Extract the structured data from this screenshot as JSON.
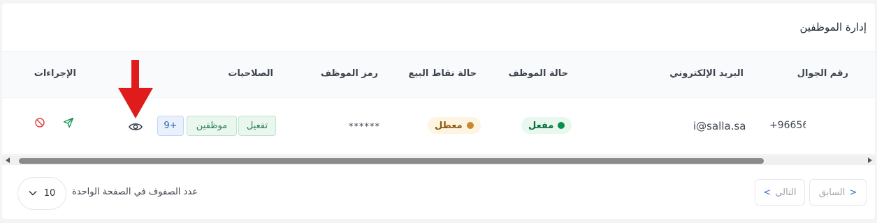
{
  "title": "إدارة الموظفين",
  "columns": {
    "mobile": "رقم الجوال",
    "email": "البريد الإلكتروني",
    "employee_status": "حالة الموظف",
    "pos_status": "حالة نقاط البيع",
    "employee_code": "رمز الموظف",
    "permissions": "الصلاحيات",
    "actions": "الإجراءات"
  },
  "row": {
    "mobile": "+96656",
    "email": "i@salla.sa",
    "employee_status": "مفعل",
    "pos_status": "معطل",
    "employee_code": "******",
    "permissions": [
      "تفعيل",
      "موظفين"
    ],
    "permissions_more": "9+"
  },
  "pagination": {
    "previous": "السابق",
    "next": "التالي",
    "rows_per_page_label": "عدد الصفوف في الصفحة الواحدة",
    "rows_per_page_value": "10"
  },
  "colors": {
    "active_green": "#0a8f4a",
    "disabled_orange": "#c98a2b",
    "permission_green": "#2e7d4f",
    "more_blue": "#2c5fb3",
    "red_arrow": "#e01b1b"
  },
  "icons": {
    "view": "eye-icon",
    "send": "send-icon",
    "block": "block-icon",
    "annotation": "red-arrow-icon"
  }
}
